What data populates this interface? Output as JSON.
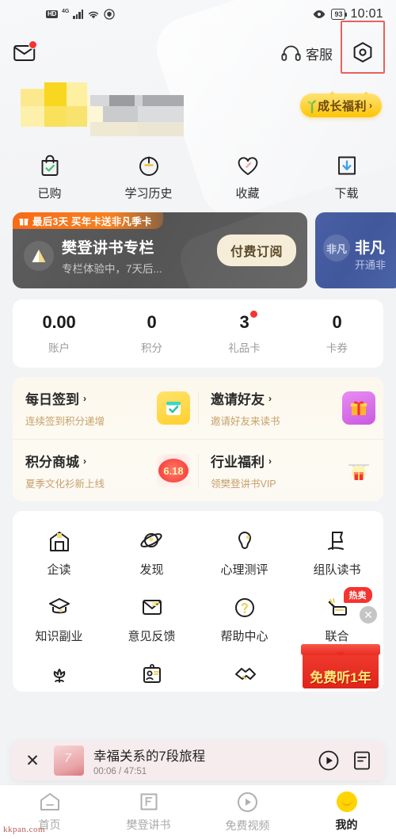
{
  "status_bar": {
    "hd_label": "HD",
    "network": "4G",
    "battery": "93",
    "time": "10:01"
  },
  "header": {
    "mail_icon": "mail-icon",
    "has_unread": true,
    "support_label": "客服",
    "support_icon": "headset-icon",
    "settings_icon": "gear-icon",
    "highlight_color": "#e8615d"
  },
  "profile": {
    "name_masked": true,
    "growth_badge": {
      "label": "成长福利",
      "chevron": "›",
      "bg_color": "#ffd23d",
      "text_color": "#6b4a10"
    }
  },
  "quick_actions": [
    {
      "label": "已购",
      "icon": "bag-check-icon"
    },
    {
      "label": "学习历史",
      "icon": "history-clock-icon"
    },
    {
      "label": "收藏",
      "icon": "heart-icon"
    },
    {
      "label": "下载",
      "icon": "download-icon"
    }
  ],
  "member_cards": {
    "dark": {
      "ribbon": "最后3天 买年卡送非凡季卡",
      "ribbon_icon": "gift-icon",
      "title": "樊登讲书专栏",
      "subtitle": "专栏体验中，7天后...",
      "button": "付费订阅",
      "bg_color": "#5d5d5d",
      "ribbon_color": "#f8801f",
      "button_color": "#f6edd8"
    },
    "blue": {
      "badge": "非凡",
      "title": "非凡",
      "subtitle": "开通非",
      "bg_color": "#4a5fa5"
    }
  },
  "stats": [
    {
      "value": "0.00",
      "label": "账户",
      "badge": false
    },
    {
      "value": "0",
      "label": "积分",
      "badge": false
    },
    {
      "value": "3",
      "label": "礼品卡",
      "badge": true
    },
    {
      "value": "0",
      "label": "卡券",
      "badge": false
    }
  ],
  "benefits": [
    {
      "title": "每日签到",
      "chevron": "›",
      "subtitle": "连续签到积分递增",
      "icon": "calendar-check-icon",
      "emoji": "✅",
      "icon_bg": "#ffd84d"
    },
    {
      "title": "邀请好友",
      "chevron": "›",
      "subtitle": "邀请好友来读书",
      "icon": "gift-box-icon",
      "emoji": "🎁",
      "icon_bg": "#e06ae8"
    },
    {
      "title": "积分商城",
      "chevron": "›",
      "subtitle": "夏季文化衫新上线",
      "icon": "sale-618-icon",
      "emoji": "6.18",
      "icon_bg": "#f5332f"
    },
    {
      "title": "行业福利",
      "chevron": "›",
      "subtitle": "领樊登讲书VIP",
      "icon": "parachute-gift-icon",
      "emoji": "🪂",
      "icon_bg": "#ffe9a8"
    }
  ],
  "services": [
    {
      "label": "企读",
      "icon": "building-icon",
      "badge": ""
    },
    {
      "label": "发现",
      "icon": "planet-icon",
      "badge": ""
    },
    {
      "label": "心理测评",
      "icon": "mind-test-icon",
      "badge": ""
    },
    {
      "label": "组队读书",
      "icon": "flag-icon",
      "badge": ""
    },
    {
      "label": "知识副业",
      "icon": "graduation-cap-icon",
      "badge": ""
    },
    {
      "label": "意见反馈",
      "icon": "envelope-feedback-icon",
      "badge": ""
    },
    {
      "label": "帮助中心",
      "icon": "question-circle-icon",
      "badge": ""
    },
    {
      "label": "联合",
      "icon": "coupon-hand-icon",
      "badge": "热卖"
    },
    {
      "label": "",
      "icon": "flower-icon",
      "badge": ""
    },
    {
      "label": "",
      "icon": "id-card-icon",
      "badge": ""
    },
    {
      "label": "",
      "icon": "handshake-icon",
      "badge": ""
    },
    {
      "label": "",
      "icon": "star-refresh-icon",
      "badge": ""
    }
  ],
  "float_ad": {
    "text": "免费听1年",
    "close_icon": "close-icon",
    "bg_color": "#e0241c",
    "text_color": "#ffe97a"
  },
  "player": {
    "close_icon": "close-icon",
    "title": "幸福关系的7段旅程",
    "time": "00:06 / 47:51",
    "play_icon": "play-circle-icon",
    "playlist_icon": "playlist-icon"
  },
  "tabbar": [
    {
      "label": "首页",
      "icon": "home-icon",
      "active": false
    },
    {
      "label": "樊登讲书",
      "icon": "book-f-icon",
      "active": false
    },
    {
      "label": "免费视频",
      "icon": "play-circle-icon",
      "active": false
    },
    {
      "label": "我的",
      "icon": "profile-moon-icon",
      "active": true
    }
  ],
  "watermark": "kkpan.com"
}
